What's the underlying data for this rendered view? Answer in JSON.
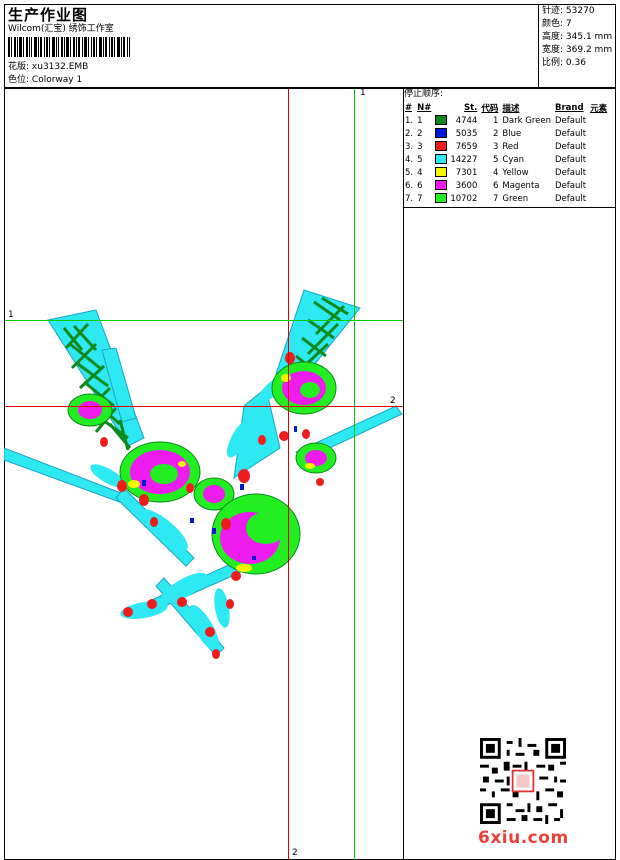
{
  "header": {
    "title": "生产作业图",
    "company": "Wilcom(汇宝) 绣饰工作室",
    "design_label": "花版:",
    "design_value": "xu3132.EMB",
    "colorway_label": "色位:",
    "colorway_value": "Colorway 1"
  },
  "stats": [
    {
      "label": "针迹:",
      "value": "53270"
    },
    {
      "label": "颜色:",
      "value": "7"
    },
    {
      "label": "高度:",
      "value": "345.1 mm"
    },
    {
      "label": "宽度:",
      "value": "369.2 mm"
    },
    {
      "label": "比例:",
      "value": "0.36"
    }
  ],
  "stop_sequence": {
    "title": "停止顺序:",
    "columns": [
      "#",
      "N#",
      "St.",
      "代码",
      "描述",
      "Brand",
      "元素"
    ],
    "rows": [
      {
        "idx": "1.",
        "n": "1",
        "color": "#0e8a1c",
        "stitches": "4744",
        "code": "1",
        "desc": "Dark Green",
        "brand": "Default"
      },
      {
        "idx": "2.",
        "n": "2",
        "color": "#0018d6",
        "stitches": "5035",
        "code": "2",
        "desc": "Blue",
        "brand": "Default"
      },
      {
        "idx": "3.",
        "n": "3",
        "color": "#ee1c1c",
        "stitches": "7659",
        "code": "3",
        "desc": "Red",
        "brand": "Default"
      },
      {
        "idx": "4.",
        "n": "5",
        "color": "#2ee8f2",
        "stitches": "14227",
        "code": "5",
        "desc": "Cyan",
        "brand": "Default"
      },
      {
        "idx": "5.",
        "n": "4",
        "color": "#f6f600",
        "stitches": "7301",
        "code": "4",
        "desc": "Yellow",
        "brand": "Default"
      },
      {
        "idx": "6.",
        "n": "6",
        "color": "#ee1cee",
        "stitches": "3600",
        "code": "6",
        "desc": "Magenta",
        "brand": "Default"
      },
      {
        "idx": "7.",
        "n": "7",
        "color": "#22ee22",
        "stitches": "10702",
        "code": "7",
        "desc": "Green",
        "brand": "Default"
      }
    ]
  },
  "guides": {
    "green_top_label": "1",
    "green_left_label": "1",
    "red_right_label": "2",
    "red_bottom_label": "2"
  },
  "watermark": "6xiu.com",
  "colors": {
    "guide_red": "#e00000",
    "guide_green": "#00cc00"
  },
  "icons": [
    "barcode-icon",
    "qr-code-icon",
    "embroidery-design"
  ]
}
